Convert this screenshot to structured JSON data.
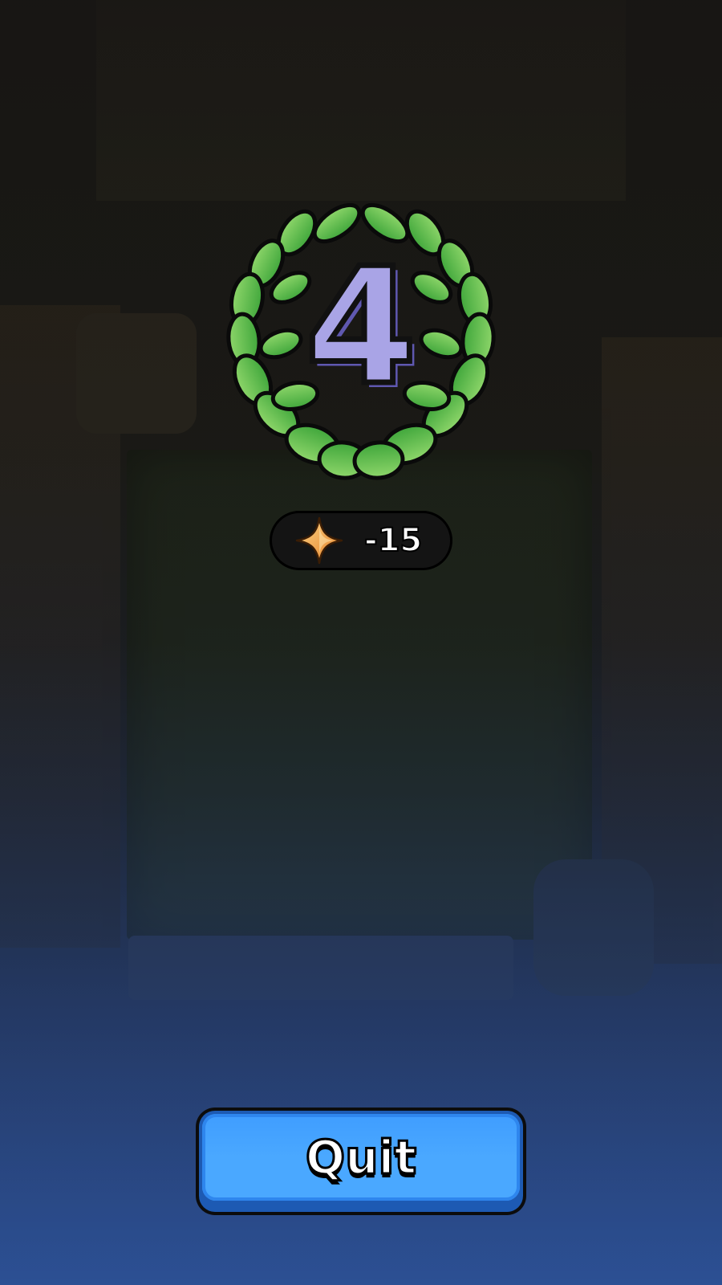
{
  "result": {
    "rank": "4",
    "trophy_change": "-15",
    "trophy_icon": "star-trophy-icon",
    "laurel_icon": "laurel-wreath-icon"
  },
  "actions": {
    "quit_label": "Quit"
  },
  "colors": {
    "button_blue": "#4aa8ff",
    "laurel_green": "#5cc04a",
    "rank_purple": "#a9a4e6",
    "trophy_gold": "#f5a43a"
  }
}
